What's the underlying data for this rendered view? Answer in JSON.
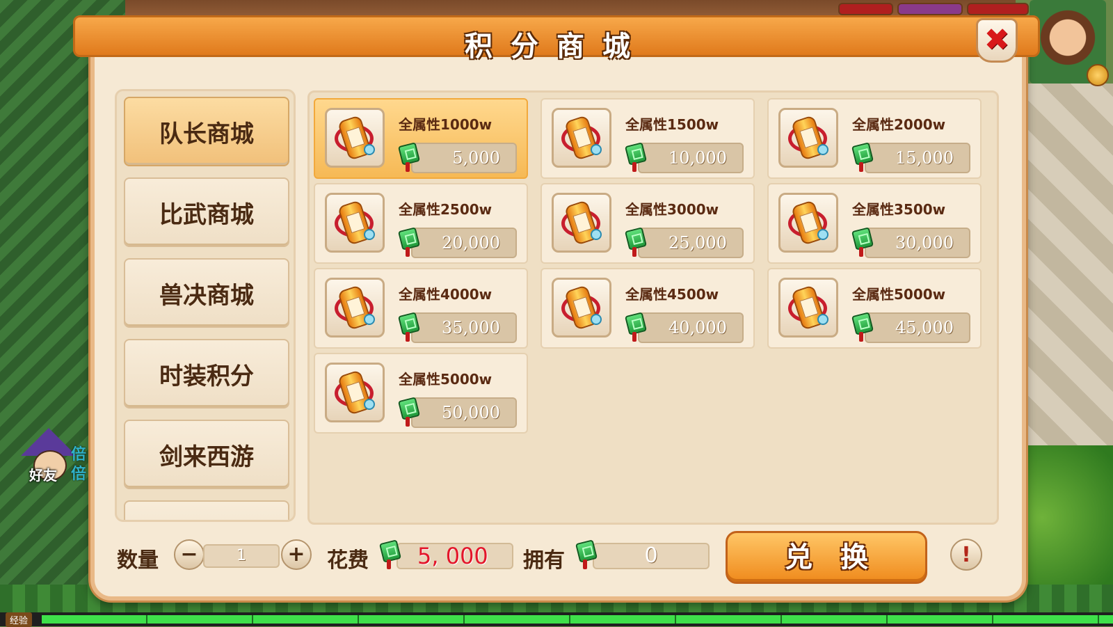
{
  "window": {
    "title": "积分商城",
    "close_icon": "✖"
  },
  "sidebar": {
    "tabs": [
      {
        "label": "队长商城",
        "active": true
      },
      {
        "label": "比武商城",
        "active": false
      },
      {
        "label": "兽决商城",
        "active": false
      },
      {
        "label": "时装积分",
        "active": false
      },
      {
        "label": "剑来西游",
        "active": false
      }
    ]
  },
  "items": [
    {
      "name": "全属性1000w",
      "price": "5,000",
      "icon": "scroll-icon",
      "selected": true
    },
    {
      "name": "全属性1500w",
      "price": "10,000",
      "icon": "scroll-icon"
    },
    {
      "name": "全属性2000w",
      "price": "15,000",
      "icon": "scroll-icon"
    },
    {
      "name": "全属性2500w",
      "price": "20,000",
      "icon": "scroll-icon"
    },
    {
      "name": "全属性3000w",
      "price": "25,000",
      "icon": "scroll-icon"
    },
    {
      "name": "全属性3500w",
      "price": "30,000",
      "icon": "scroll-icon"
    },
    {
      "name": "全属性4000w",
      "price": "35,000",
      "icon": "scroll-icon"
    },
    {
      "name": "全属性4500w",
      "price": "40,000",
      "icon": "scroll-icon"
    },
    {
      "name": "全属性5000w",
      "price": "45,000",
      "icon": "scroll-icon"
    },
    {
      "name": "全属性5000w",
      "price": "50,000",
      "icon": "scroll-icon"
    }
  ],
  "footer": {
    "qty_label": "数量",
    "minus_label": "−",
    "plus_label": "+",
    "qty_value": "1",
    "cost_label": "花费",
    "cost_value": "5, 000",
    "own_label": "拥有",
    "own_value": "0",
    "exchange_label": "兑换",
    "info_label": "!"
  },
  "hud": {
    "friend_label": "好友",
    "side_label": "倍倍",
    "xp_label": "经验"
  },
  "colors": {
    "accent": "#f1a43c",
    "price_red": "#e3162a",
    "panel": "#f6e9d4"
  }
}
